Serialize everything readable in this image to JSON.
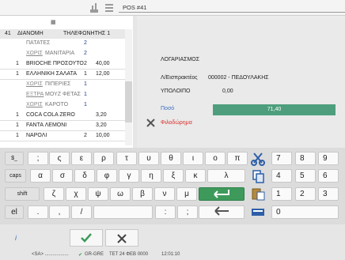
{
  "window": {
    "title": "POS #41"
  },
  "order": {
    "header": {
      "num": "41",
      "type": "ΔΙΑΝΟΜΗ",
      "phone": "ΤΗΛΕΦΩΝΗΤΗΣ 1"
    },
    "rows": [
      {
        "qty": "",
        "name": "ΠΑΤΑΤΕΣ",
        "prefix": "",
        "count": "2",
        "price": "",
        "sub": true
      },
      {
        "qty": "",
        "name": "ΜΑΝΙΤΑΡΙΑ",
        "prefix": "ΧΩΡΙΣ",
        "count": "2",
        "price": "",
        "sub": true
      },
      {
        "qty": "1",
        "name": "BRIOCHE ΠΡΟΣΟΥΤΟ",
        "prefix": "",
        "count": "2",
        "price": "40,00",
        "sub": false
      },
      {
        "qty": "1",
        "name": "ΕΛΛΗΝΙΚΗ ΣΑΛΑΤΑ",
        "prefix": "",
        "count": "1",
        "price": "12,00",
        "sub": false
      },
      {
        "qty": "",
        "name": "ΠΙΠΕΡΙΕΣ",
        "prefix": "ΧΩΡΙΣ",
        "count": "1",
        "price": "",
        "sub": true
      },
      {
        "qty": "",
        "name": "ΜΟΥΖ ΦΕΤΑΣ",
        "prefix": "ΕΞΤΡΑ",
        "count": "1",
        "price": "",
        "sub": true
      },
      {
        "qty": "",
        "name": "ΚΑΡΟΤΟ",
        "prefix": "ΧΩΡΙΣ",
        "count": "1",
        "price": "",
        "sub": true
      },
      {
        "qty": "1",
        "name": "COCA COLA ZERO",
        "prefix": "",
        "count": "",
        "price": "3,20",
        "sub": false
      },
      {
        "qty": "1",
        "name": "FANTA ΛΕΜΟΝΙ",
        "prefix": "",
        "count": "",
        "price": "3,20",
        "sub": false
      },
      {
        "qty": "1",
        "name": "ΝΑΡΟΛΙ",
        "prefix": "",
        "count": "2",
        "price": "10,00",
        "sub": false
      }
    ]
  },
  "account": {
    "title": "ΛΟΓΑΡΙΑΣΜΟΣ",
    "collector_label": "Λ/Εισπρακτέος",
    "collector_value": "000002 - ΠΕΔΟΥΛΑΚΗΣ",
    "balance_label": "ΥΠΟΛΟΙΠΟ",
    "balance_value": "0,00",
    "amount_label": "Ποσό",
    "amount_value": "71,40",
    "tip_label": "Φιλοδώρημα"
  },
  "keyboard": {
    "row1": [
      "$_",
      ";",
      "ς",
      "ε",
      "ρ",
      "τ",
      "υ",
      "θ",
      "ι",
      "ο",
      "π"
    ],
    "row2": [
      "caps",
      "α",
      "σ",
      "δ",
      "φ",
      "γ",
      "η",
      "ξ",
      "κ",
      "λ"
    ],
    "row3": [
      "shift",
      "ζ",
      "χ",
      "ψ",
      "ω",
      "β",
      "ν",
      "μ"
    ],
    "row4": [
      "el",
      ".",
      ",",
      "/",
      "",
      ":",
      ";"
    ],
    "numpad": [
      "7",
      "8",
      "9",
      "4",
      "5",
      "6",
      "1",
      "2",
      "3",
      "0"
    ]
  },
  "status": {
    "user": "<SA> ..................",
    "locale": "GR-GRE",
    "date": "ΤΕΤ 24 ΦΕΒ 0000",
    "time": "12:01:10"
  },
  "colors": {
    "accent": "#4e9e7d",
    "enter": "#3e9a5b",
    "danger": "#d9312b",
    "link": "#3b6fbf"
  }
}
